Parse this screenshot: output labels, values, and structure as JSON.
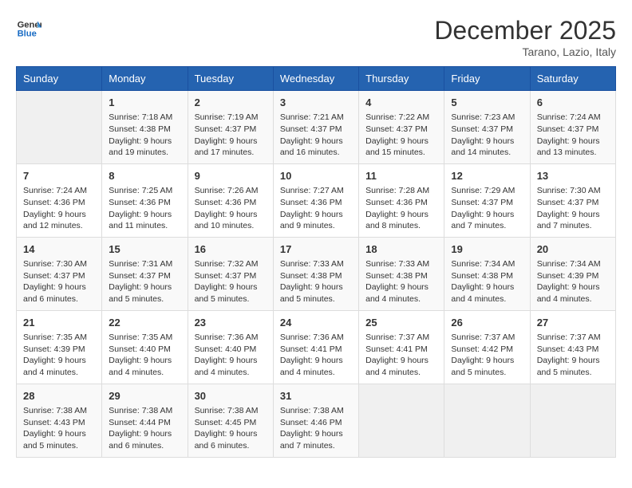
{
  "header": {
    "logo_general": "General",
    "logo_blue": "Blue",
    "month_title": "December 2025",
    "location": "Tarano, Lazio, Italy"
  },
  "weekdays": [
    "Sunday",
    "Monday",
    "Tuesday",
    "Wednesday",
    "Thursday",
    "Friday",
    "Saturday"
  ],
  "weeks": [
    [
      {
        "day": "",
        "info": ""
      },
      {
        "day": "1",
        "info": "Sunrise: 7:18 AM\nSunset: 4:38 PM\nDaylight: 9 hours\nand 19 minutes."
      },
      {
        "day": "2",
        "info": "Sunrise: 7:19 AM\nSunset: 4:37 PM\nDaylight: 9 hours\nand 17 minutes."
      },
      {
        "day": "3",
        "info": "Sunrise: 7:21 AM\nSunset: 4:37 PM\nDaylight: 9 hours\nand 16 minutes."
      },
      {
        "day": "4",
        "info": "Sunrise: 7:22 AM\nSunset: 4:37 PM\nDaylight: 9 hours\nand 15 minutes."
      },
      {
        "day": "5",
        "info": "Sunrise: 7:23 AM\nSunset: 4:37 PM\nDaylight: 9 hours\nand 14 minutes."
      },
      {
        "day": "6",
        "info": "Sunrise: 7:24 AM\nSunset: 4:37 PM\nDaylight: 9 hours\nand 13 minutes."
      }
    ],
    [
      {
        "day": "7",
        "info": "Sunrise: 7:24 AM\nSunset: 4:36 PM\nDaylight: 9 hours\nand 12 minutes."
      },
      {
        "day": "8",
        "info": "Sunrise: 7:25 AM\nSunset: 4:36 PM\nDaylight: 9 hours\nand 11 minutes."
      },
      {
        "day": "9",
        "info": "Sunrise: 7:26 AM\nSunset: 4:36 PM\nDaylight: 9 hours\nand 10 minutes."
      },
      {
        "day": "10",
        "info": "Sunrise: 7:27 AM\nSunset: 4:36 PM\nDaylight: 9 hours\nand 9 minutes."
      },
      {
        "day": "11",
        "info": "Sunrise: 7:28 AM\nSunset: 4:36 PM\nDaylight: 9 hours\nand 8 minutes."
      },
      {
        "day": "12",
        "info": "Sunrise: 7:29 AM\nSunset: 4:37 PM\nDaylight: 9 hours\nand 7 minutes."
      },
      {
        "day": "13",
        "info": "Sunrise: 7:30 AM\nSunset: 4:37 PM\nDaylight: 9 hours\nand 7 minutes."
      }
    ],
    [
      {
        "day": "14",
        "info": "Sunrise: 7:30 AM\nSunset: 4:37 PM\nDaylight: 9 hours\nand 6 minutes."
      },
      {
        "day": "15",
        "info": "Sunrise: 7:31 AM\nSunset: 4:37 PM\nDaylight: 9 hours\nand 5 minutes."
      },
      {
        "day": "16",
        "info": "Sunrise: 7:32 AM\nSunset: 4:37 PM\nDaylight: 9 hours\nand 5 minutes."
      },
      {
        "day": "17",
        "info": "Sunrise: 7:33 AM\nSunset: 4:38 PM\nDaylight: 9 hours\nand 5 minutes."
      },
      {
        "day": "18",
        "info": "Sunrise: 7:33 AM\nSunset: 4:38 PM\nDaylight: 9 hours\nand 4 minutes."
      },
      {
        "day": "19",
        "info": "Sunrise: 7:34 AM\nSunset: 4:38 PM\nDaylight: 9 hours\nand 4 minutes."
      },
      {
        "day": "20",
        "info": "Sunrise: 7:34 AM\nSunset: 4:39 PM\nDaylight: 9 hours\nand 4 minutes."
      }
    ],
    [
      {
        "day": "21",
        "info": "Sunrise: 7:35 AM\nSunset: 4:39 PM\nDaylight: 9 hours\nand 4 minutes."
      },
      {
        "day": "22",
        "info": "Sunrise: 7:35 AM\nSunset: 4:40 PM\nDaylight: 9 hours\nand 4 minutes."
      },
      {
        "day": "23",
        "info": "Sunrise: 7:36 AM\nSunset: 4:40 PM\nDaylight: 9 hours\nand 4 minutes."
      },
      {
        "day": "24",
        "info": "Sunrise: 7:36 AM\nSunset: 4:41 PM\nDaylight: 9 hours\nand 4 minutes."
      },
      {
        "day": "25",
        "info": "Sunrise: 7:37 AM\nSunset: 4:41 PM\nDaylight: 9 hours\nand 4 minutes."
      },
      {
        "day": "26",
        "info": "Sunrise: 7:37 AM\nSunset: 4:42 PM\nDaylight: 9 hours\nand 5 minutes."
      },
      {
        "day": "27",
        "info": "Sunrise: 7:37 AM\nSunset: 4:43 PM\nDaylight: 9 hours\nand 5 minutes."
      }
    ],
    [
      {
        "day": "28",
        "info": "Sunrise: 7:38 AM\nSunset: 4:43 PM\nDaylight: 9 hours\nand 5 minutes."
      },
      {
        "day": "29",
        "info": "Sunrise: 7:38 AM\nSunset: 4:44 PM\nDaylight: 9 hours\nand 6 minutes."
      },
      {
        "day": "30",
        "info": "Sunrise: 7:38 AM\nSunset: 4:45 PM\nDaylight: 9 hours\nand 6 minutes."
      },
      {
        "day": "31",
        "info": "Sunrise: 7:38 AM\nSunset: 4:46 PM\nDaylight: 9 hours\nand 7 minutes."
      },
      {
        "day": "",
        "info": ""
      },
      {
        "day": "",
        "info": ""
      },
      {
        "day": "",
        "info": ""
      }
    ]
  ]
}
